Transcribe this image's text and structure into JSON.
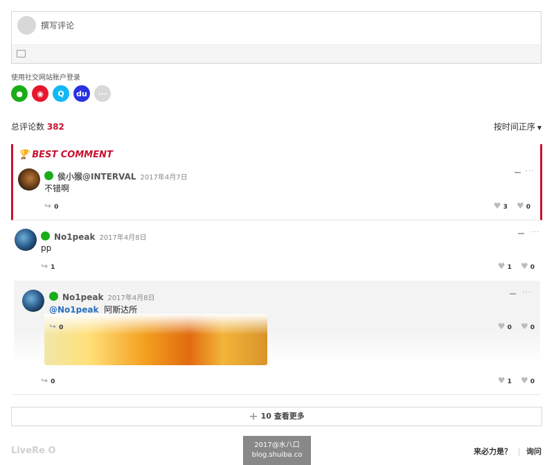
{
  "editor": {
    "placeholder": "撰写评论"
  },
  "social": {
    "label": "使用社交网站账户登录",
    "icons": [
      {
        "name": "wechat",
        "color": "#1aad19",
        "glyph": "●"
      },
      {
        "name": "weibo",
        "color": "#e6162d",
        "glyph": "◉"
      },
      {
        "name": "qq",
        "color": "#12b7f5",
        "glyph": "Q"
      },
      {
        "name": "baidu",
        "color": "#2932e1",
        "glyph": "du"
      },
      {
        "name": "more",
        "color": "#d8d8d8",
        "glyph": "···"
      }
    ]
  },
  "summary": {
    "total_label": "总评论数",
    "total_count": "382",
    "sort_label": "按时间正序"
  },
  "best": {
    "title": "BEST COMMENT",
    "name": "侯小猴@INTERVAL",
    "date": "2017年4月7日",
    "text": "不错啊",
    "replies": "0",
    "likes": "3",
    "dislikes": "0"
  },
  "comment1": {
    "name": "No1peak",
    "date": "2017年4月8日",
    "text": "pp",
    "replies": "1",
    "likes": "1",
    "dislikes": "0"
  },
  "reply1": {
    "name": "No1peak",
    "date": "2017年4月8日",
    "mention": "@No1peak",
    "text": "阿斯达所",
    "replies": "0",
    "likes": "0",
    "dislikes": "0",
    "replies_bottom": "0",
    "likes_bottom": "1",
    "dislikes_bottom": "0"
  },
  "more": {
    "count": "10",
    "label": "查看更多"
  },
  "footer": {
    "logo": "LiveRe O",
    "watermark_line1": "2017@水八口",
    "watermark_line2": "blog.shuiba.co",
    "link1": "来必力是？",
    "link2": "询问"
  }
}
